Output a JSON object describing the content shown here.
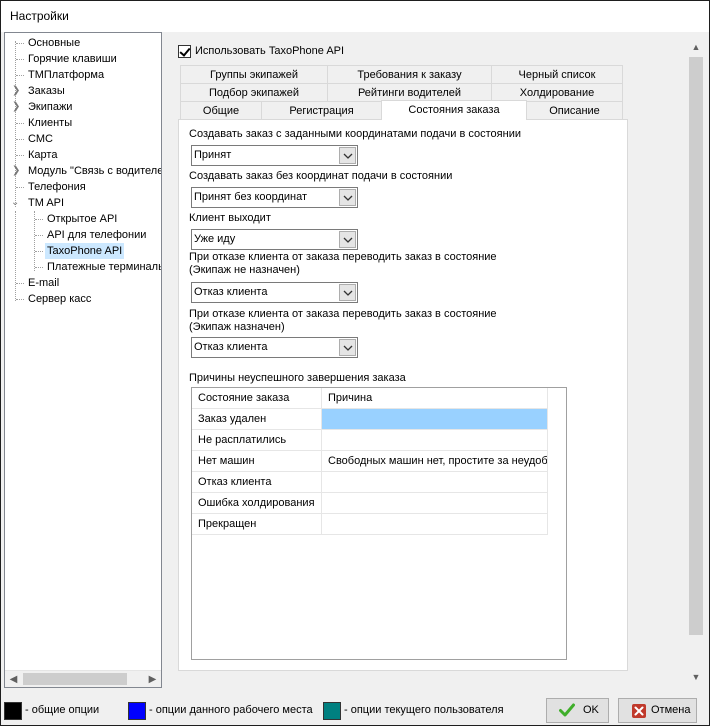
{
  "window": {
    "title": "Настройки"
  },
  "tree": {
    "items": [
      {
        "label": "Основные"
      },
      {
        "label": "Горячие клавиши"
      },
      {
        "label": "ТМПлатформа"
      },
      {
        "label": "Заказы"
      },
      {
        "label": "Экипажи"
      },
      {
        "label": "Клиенты"
      },
      {
        "label": "СМС"
      },
      {
        "label": "Карта"
      },
      {
        "label": "Модуль \"Связь с водителем\""
      },
      {
        "label": "Телефония"
      },
      {
        "label": "TM API"
      },
      {
        "label": "Открытое API"
      },
      {
        "label": "API для телефонии"
      },
      {
        "label": "TaxoPhone API"
      },
      {
        "label": "Платежные терминалы"
      },
      {
        "label": "E-mail"
      },
      {
        "label": "Сервер касс"
      }
    ]
  },
  "use_api": {
    "label": "Использовать TaxoPhone API",
    "checked": true
  },
  "tabs": {
    "row1": [
      "Группы экипажей",
      "Требования к заказу",
      "Черный список"
    ],
    "row2": [
      "Подбор экипажей",
      "Рейтинги водителей",
      "Холдирование"
    ],
    "row3": [
      "Общие",
      "Регистрация",
      "Состояния заказа",
      "Описание"
    ],
    "active": "Состояния заказа"
  },
  "form": {
    "create_with_coords_label": "Создавать заказ с заданными координатами подачи в состоянии",
    "create_with_coords_value": "Принят",
    "create_without_coords_label": "Создавать заказ без координат подачи в состоянии",
    "create_without_coords_value": "Принят без координат",
    "client_out_label": "Клиент выходит",
    "client_out_value": "Уже иду",
    "refusal_no_crew_label1": "При отказе клиента от заказа переводить заказ в состояние",
    "refusal_no_crew_label2": "(Экипаж не назначен)",
    "refusal_no_crew_value": "Отказ клиента",
    "refusal_crew_label1": "При отказе клиента от заказа переводить заказ в состояние",
    "refusal_crew_label2": "(Экипаж назначен)",
    "refusal_crew_value": "Отказ клиента",
    "fail_reasons_label": "Причины неуспешного завершения заказа"
  },
  "table": {
    "headers": [
      "Состояние заказа",
      "Причина"
    ],
    "rows": [
      {
        "state": "Заказ удален",
        "reason": ""
      },
      {
        "state": "Не расплатились",
        "reason": ""
      },
      {
        "state": "Нет машин",
        "reason": "Свободных машин нет, простите за неудобство"
      },
      {
        "state": "Отказ клиента",
        "reason": ""
      },
      {
        "state": "Ошибка холдирования",
        "reason": ""
      },
      {
        "state": "Прекращен",
        "reason": ""
      }
    ]
  },
  "legend": {
    "general": "- общие опции",
    "workplace": "- опции данного рабочего места",
    "user": "- опции текущего пользователя",
    "colors": {
      "general": "#000000",
      "workplace": "#0000ff",
      "user": "#008080"
    }
  },
  "buttons": {
    "ok": "OK",
    "cancel": "Отмена"
  },
  "colors": {
    "selection": "#cce8ff",
    "cell_highlight": "#99d1ff",
    "ok_icon": "#3fae2a",
    "cancel_icon": "#c0392b"
  }
}
